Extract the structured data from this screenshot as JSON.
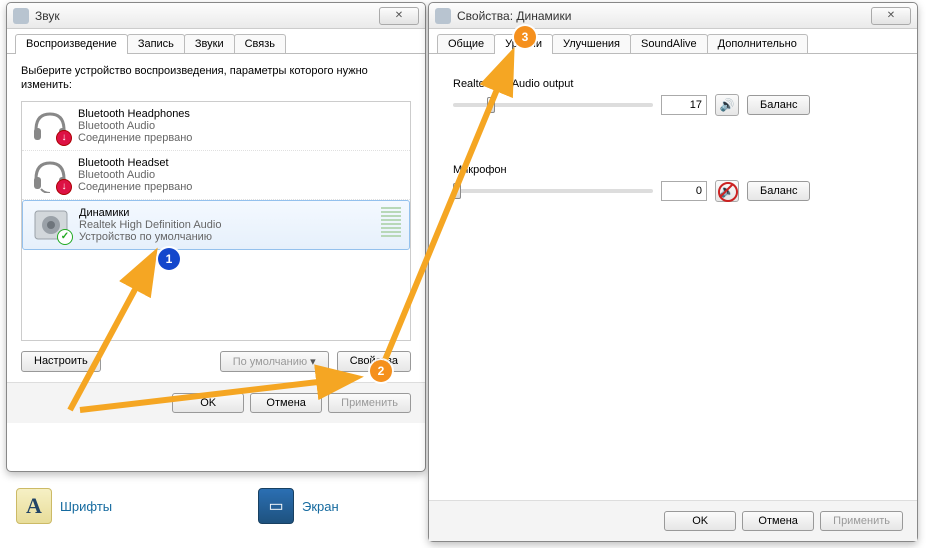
{
  "sound_window": {
    "title": "Звук",
    "tabs": [
      "Воспроизведение",
      "Запись",
      "Звуки",
      "Связь"
    ],
    "active_tab": 0,
    "instructions": "Выберите устройство воспроизведения, параметры которого нужно изменить:",
    "devices": [
      {
        "name": "Bluetooth Headphones",
        "desc": "Bluetooth Audio",
        "status": "Соединение прервано"
      },
      {
        "name": "Bluetooth Headset",
        "desc": "Bluetooth Audio",
        "status": "Соединение прервано"
      },
      {
        "name": "Динамики",
        "desc": "Realtek High Definition Audio",
        "status": "Устройство по умолчанию"
      }
    ],
    "configure_btn": "Настроить",
    "default_btn": "По умолчанию",
    "properties_btn": "Свойства",
    "ok": "OK",
    "cancel": "Отмена",
    "apply": "Применить"
  },
  "properties_window": {
    "title": "Свойства: Динамики",
    "tabs": [
      "Общие",
      "Уровни",
      "Улучшения",
      "SoundAlive",
      "Дополнительно"
    ],
    "active_tab": 1,
    "levels": [
      {
        "label": "Realtek HD Audio output",
        "value": 17,
        "muted": false,
        "balance": "Баланс"
      },
      {
        "label": "Микрофон",
        "value": 0,
        "muted": true,
        "balance": "Баланс"
      }
    ],
    "ok": "OK",
    "cancel": "Отмена",
    "apply": "Применить"
  },
  "annotation": {
    "marker1": "1",
    "marker2": "2",
    "marker3": "3"
  },
  "desktop": {
    "fonts": "Шрифты",
    "screen": "Экран"
  }
}
